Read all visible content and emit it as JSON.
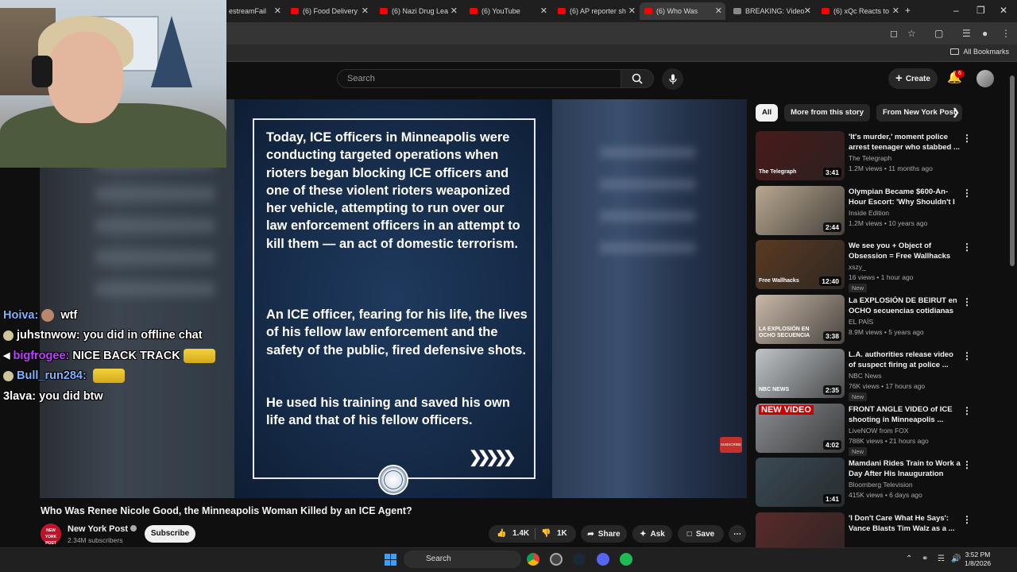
{
  "browser": {
    "tabs": [
      {
        "title": "estreamFail"
      },
      {
        "title": "(6) Food Delivery"
      },
      {
        "title": "(6) Nazi Drug Lea"
      },
      {
        "title": "(6) YouTube"
      },
      {
        "title": "(6) AP reporter sh"
      },
      {
        "title": "(6) Who Was"
      },
      {
        "title": "BREAKING: Video"
      },
      {
        "title": "(6) xQc Reacts to"
      }
    ],
    "new_tab": "+",
    "all_bookmarks": "All Bookmarks"
  },
  "youtube": {
    "search_placeholder": "Search",
    "create_label": "Create",
    "notifications_count": "6"
  },
  "player": {
    "statement_paragraphs": [
      "Today, ICE officers in Minneapolis were conducting targeted operations when rioters began blocking ICE officers and one of these violent rioters weaponized her vehicle, attempting to run over our law enforcement officers in an attempt to kill them — an act of domestic terrorism.",
      "An ICE officer, fearing for his life, the lives of his fellow law enforcement and the safety of the public, fired defensive shots.",
      "He used his training and saved his own life and that of his fellow officers."
    ],
    "arrows": "❯❯❯❯❯",
    "subscribe_watermark": "SUBSCRIBE"
  },
  "chat": [
    {
      "user": "Hoiva:",
      "user_color": "#7fb2ff",
      "message": "wtf",
      "badge": "face"
    },
    {
      "user": "juhstnwow:",
      "user_color": "#ffffff",
      "message": "you did in offline chat",
      "badge": "dot"
    },
    {
      "user": "bigfrogee:",
      "user_color": "#c040ff",
      "message": "NICE BACK TRACK",
      "badge": "mute",
      "emote": true
    },
    {
      "user": "Bull_run284:",
      "user_color": "#7fb2ff",
      "message": "",
      "badge": "dot",
      "emote": true
    },
    {
      "user": "3lava:",
      "user_color": "#ffffff",
      "message": "you did btw",
      "badge": "none"
    }
  ],
  "video": {
    "title": "Who Was Renee Nicole Good, the Minneapolis Woman Killed by an ICE Agent?",
    "channel": "New York Post",
    "channel_avatar_text": "NEW YORK POST",
    "subscribers": "2.34M subscribers",
    "subscribe_label": "Subscribe",
    "likes": "1.4K",
    "dislikes": "1K",
    "share_label": "Share",
    "ask_label": "Ask",
    "save_label": "Save"
  },
  "sidebar": {
    "chips": [
      "All",
      "More from this story",
      "From New York Post"
    ],
    "items": [
      {
        "title": "'It's murder,' moment police arrest teenager who stabbed ...",
        "channel": "The Telegraph",
        "meta": "1.2M views • 11 months ago",
        "duration": "3:41",
        "new": false,
        "thumb": "#4a1a1a",
        "thumb_text": "The Telegraph"
      },
      {
        "title": "Olympian Became $600-An-Hour Escort: 'Why Shouldn't I ...",
        "channel": "Inside Edition",
        "meta": "1.2M views • 10 years ago",
        "duration": "2:44",
        "new": false,
        "thumb": "#b9a890",
        "thumb_text": ""
      },
      {
        "title": "We see you + Object of Obsession = Free Wallhacks :D...",
        "channel": "xszy_",
        "meta": "16 views • 1 hour ago",
        "duration": "12:40",
        "new": true,
        "thumb": "#5a3a22",
        "thumb_text": "Free Wallhacks"
      },
      {
        "title": "La EXPLOSIÓN DE BEIRUT en OCHO secuencias cotidianas",
        "channel": "EL PAÍS",
        "meta": "8.9M views • 5 years ago",
        "duration": "3:38",
        "new": false,
        "thumb": "#c9b8a8",
        "thumb_text": "LA EXPLOSIÓN EN OCHO SECUENCIA"
      },
      {
        "title": "L.A. authorities release video of suspect firing at police ...",
        "channel": "NBC News",
        "meta": "76K views • 17 hours ago",
        "duration": "2:35",
        "new": true,
        "thumb": "#bfc4c8",
        "thumb_text": "NBC NEWS"
      },
      {
        "title": "FRONT ANGLE VIDEO of ICE shooting in Minneapolis ...",
        "channel": "LiveNOW from FOX",
        "meta": "788K views • 21 hours ago",
        "duration": "4:02",
        "new": true,
        "thumb": "#8a8d92",
        "thumb_text": "NEW VIDEO"
      },
      {
        "title": "Mamdani Rides Train to Work a Day After His Inauguration",
        "channel": "Bloomberg Television",
        "meta": "415K views • 6 days ago",
        "duration": "1:41",
        "new": false,
        "thumb": "#3a4a55",
        "thumb_text": ""
      },
      {
        "title": "'I Don't Care What He Says': Vance Blasts Tim Walz as a ...",
        "channel": "",
        "meta": "",
        "duration": "",
        "new": false,
        "thumb": "#5a2a2a",
        "thumb_text": ""
      }
    ]
  },
  "taskbar": {
    "search_label": "Search",
    "time": "3:52 PM",
    "date": "1/8/2026"
  }
}
